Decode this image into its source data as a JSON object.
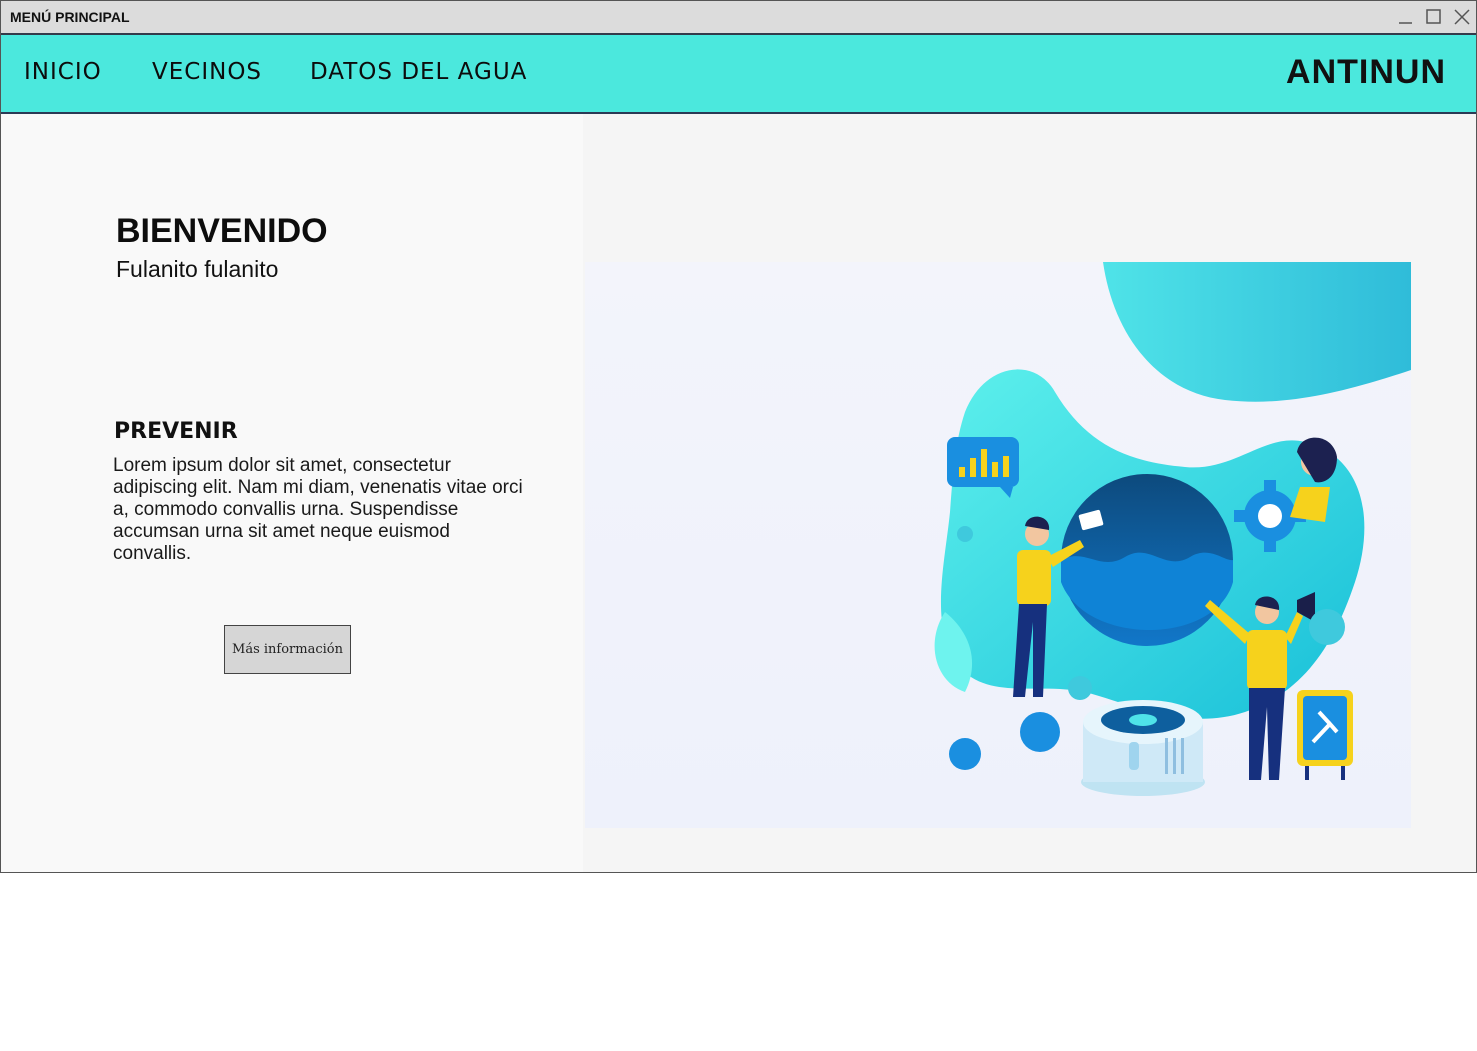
{
  "window": {
    "title": "MENÚ PRINCIPAL",
    "controls": [
      "minimize-icon",
      "maximize-icon",
      "close-icon"
    ]
  },
  "nav": {
    "items": [
      {
        "label": "INICIO"
      },
      {
        "label": "VECINOS"
      },
      {
        "label": "DATOS DEL AGUA"
      }
    ],
    "brand": "ANTINUN"
  },
  "welcome": {
    "title": "BIENVENIDO",
    "user": "Fulanito fulanito"
  },
  "section": {
    "title": "PREVENIR",
    "body": "Lorem ipsum dolor sit amet, consectetur adipiscing elit. Nam mi diam, venenatis vitae orci a, commodo convallis urna. Suspendisse accumsan urna sit amet neque euismod convallis."
  },
  "button": {
    "more_info": "Más información"
  },
  "colors": {
    "navbar": "#4be8dd",
    "accent_blue": "#1a8fe0",
    "accent_yellow": "#f6d21c"
  }
}
